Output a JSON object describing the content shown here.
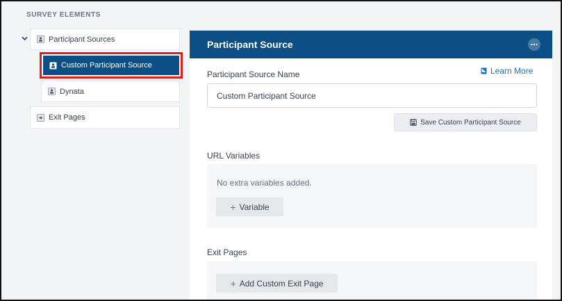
{
  "sidebar": {
    "section_title": "SURVEY ELEMENTS",
    "items": [
      {
        "label": "Participant Sources"
      },
      {
        "label": "Custom Participant Source"
      },
      {
        "label": "Dynata"
      },
      {
        "label": "Exit Pages"
      }
    ]
  },
  "panel": {
    "title": "Participant Source",
    "name_label": "Participant Source Name",
    "learn_more": "Learn More",
    "name_value": "Custom Participant Source",
    "save_label": "Save Custom Participant Source",
    "url_variables": {
      "heading": "URL Variables",
      "empty_text": "No extra variables added.",
      "add_label": "Variable"
    },
    "exit_pages": {
      "heading": "Exit Pages",
      "add_label": "Add Custom Exit Page"
    }
  },
  "colors": {
    "accent": "#0b4f86",
    "highlight_border": "#e01e1e",
    "link": "#1d6fb8"
  }
}
